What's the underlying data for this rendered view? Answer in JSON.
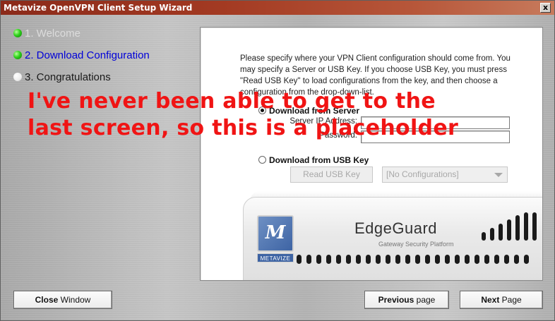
{
  "window": {
    "title": "Metavize OpenVPN Client Setup Wizard",
    "close_label": "x"
  },
  "steps": [
    {
      "label": "1. Welcome",
      "state": "done"
    },
    {
      "label": "2. Download Configuration",
      "state": "active"
    },
    {
      "label": "3. Congratulations",
      "state": "todo"
    }
  ],
  "panel": {
    "instructions": "Please specify where your VPN Client configuration should come from. You may specify a Server or USB Key. If you choose USB Key, you must press \"Read USB Key\" to load configurations from the key, and then choose a configuration from the drop-down-list.",
    "server_option": "Download from Server",
    "server_ip_label": "Server IP Address:",
    "server_ip_value": "",
    "password_label": "Password:",
    "password_value": "",
    "usb_option": "Download from USB Key",
    "read_usb_button": "Read USB Key",
    "config_select": "[No Configurations]"
  },
  "appliance": {
    "logo_glyph": "M",
    "logo_text": "METAVIZE",
    "brand": "EdgeGuard",
    "tagline": "Gateway Security Platform"
  },
  "overlay": {
    "line1": "I've never been able to get to the",
    "line2": "last screen, so this is a placeholder"
  },
  "buttons": {
    "close_bold": "Close",
    "close_rest": " Window",
    "previous_bold": "Previous",
    "previous_rest": " page",
    "next_bold": "Next",
    "next_rest": " Page"
  },
  "colors": {
    "titlebar": "#a33a22",
    "active_step": "#0000d8",
    "overlay_text": "#f01414",
    "step_dot": "#2fd31b"
  }
}
